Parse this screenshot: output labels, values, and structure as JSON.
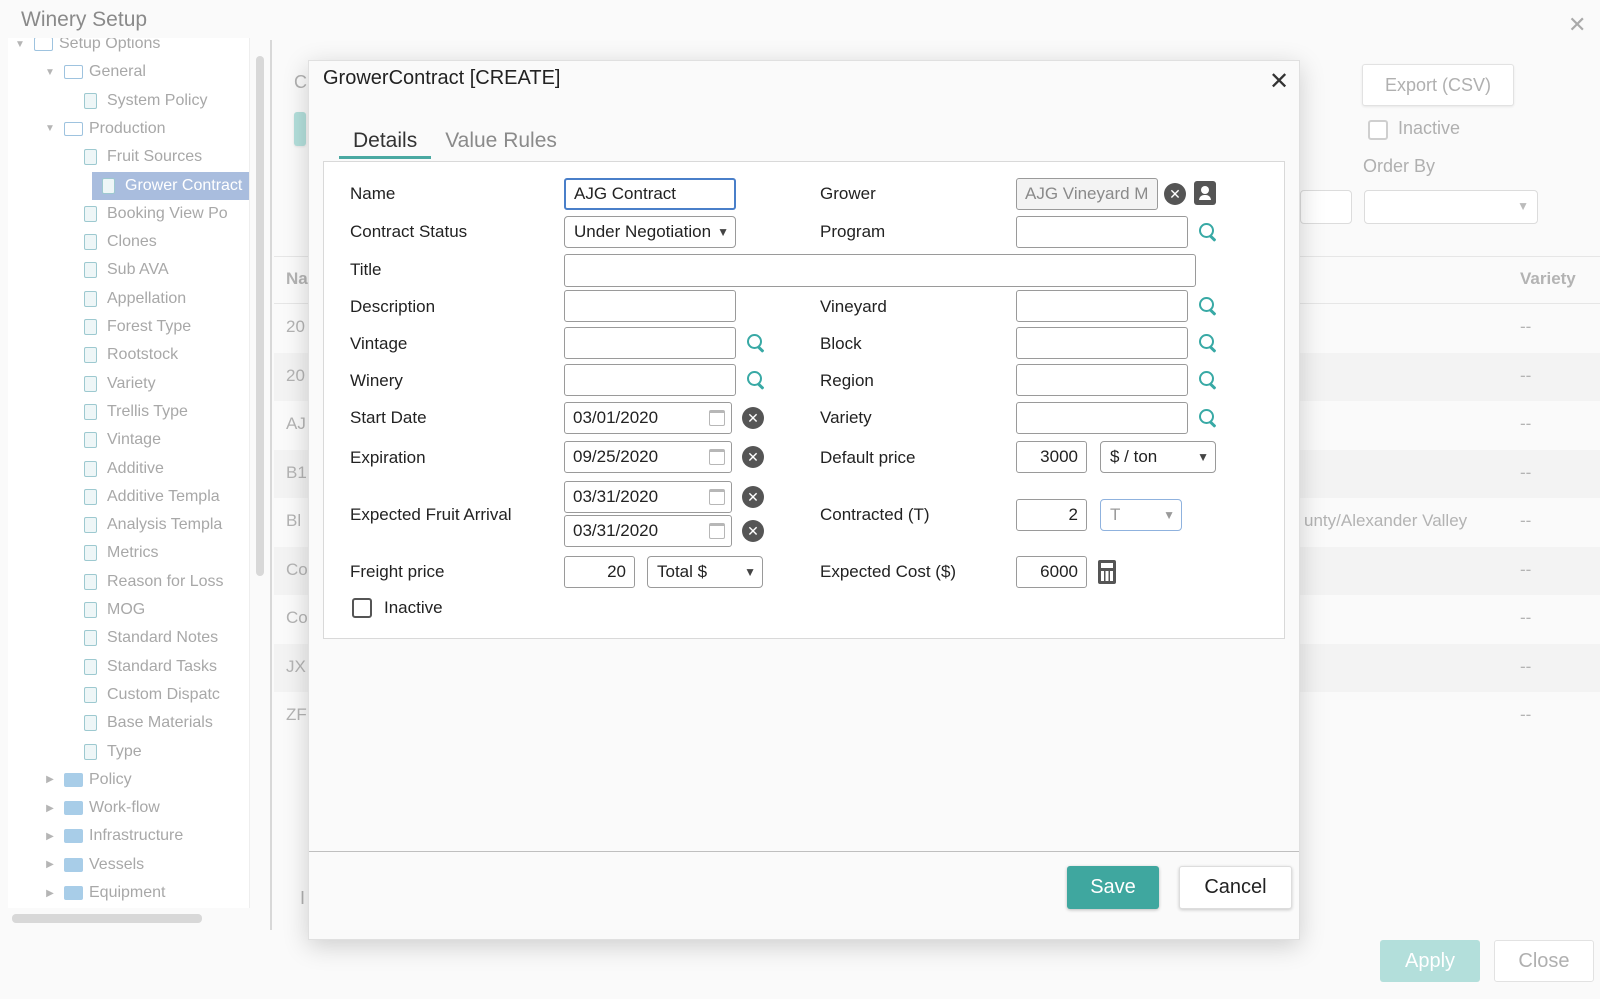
{
  "window": {
    "title": "Winery Setup",
    "close_glyph": "✕"
  },
  "tree": {
    "items": [
      {
        "label": "Setup Options",
        "kind": "folder",
        "level": 0,
        "expanded": true
      },
      {
        "label": "General",
        "kind": "folder",
        "level": 1,
        "expanded": true
      },
      {
        "label": "System Policy",
        "kind": "doc",
        "level": 2
      },
      {
        "label": "Production",
        "kind": "folder",
        "level": 1,
        "expanded": true
      },
      {
        "label": "Fruit Sources",
        "kind": "doc",
        "level": 2
      },
      {
        "label": "Grower Contract",
        "kind": "doc",
        "level": 2,
        "selected": true
      },
      {
        "label": "Booking View Po",
        "kind": "doc",
        "level": 2
      },
      {
        "label": "Clones",
        "kind": "doc",
        "level": 2
      },
      {
        "label": "Sub AVA",
        "kind": "doc",
        "level": 2
      },
      {
        "label": "Appellation",
        "kind": "doc",
        "level": 2
      },
      {
        "label": "Forest Type",
        "kind": "doc",
        "level": 2
      },
      {
        "label": "Rootstock",
        "kind": "doc",
        "level": 2
      },
      {
        "label": "Variety",
        "kind": "doc",
        "level": 2
      },
      {
        "label": "Trellis Type",
        "kind": "doc",
        "level": 2
      },
      {
        "label": "Vintage",
        "kind": "doc",
        "level": 2
      },
      {
        "label": "Additive",
        "kind": "doc",
        "level": 2
      },
      {
        "label": "Additive Templa",
        "kind": "doc",
        "level": 2
      },
      {
        "label": "Analysis Templa",
        "kind": "doc",
        "level": 2
      },
      {
        "label": "Metrics",
        "kind": "doc",
        "level": 2
      },
      {
        "label": "Reason for Loss",
        "kind": "doc",
        "level": 2
      },
      {
        "label": "MOG",
        "kind": "doc",
        "level": 2
      },
      {
        "label": "Standard Notes",
        "kind": "doc",
        "level": 2
      },
      {
        "label": "Standard Tasks",
        "kind": "doc",
        "level": 2
      },
      {
        "label": "Custom Dispatc",
        "kind": "doc",
        "level": 2
      },
      {
        "label": "Base Materials",
        "kind": "doc",
        "level": 2
      },
      {
        "label": "Type",
        "kind": "doc",
        "level": 2
      },
      {
        "label": "Policy",
        "kind": "folder-closed",
        "level": 1
      },
      {
        "label": "Work-flow",
        "kind": "folder-closed",
        "level": 1
      },
      {
        "label": "Infrastructure",
        "kind": "folder-closed",
        "level": 1
      },
      {
        "label": "Vessels",
        "kind": "folder-closed",
        "level": 1
      },
      {
        "label": "Equipment",
        "kind": "folder-closed",
        "level": 1
      }
    ]
  },
  "background": {
    "c_label": "C",
    "export_label": "Export (CSV)",
    "inactive_label": "Inactive",
    "order_by_label": "Order By",
    "col_name": "Na",
    "col_variety": "Variety",
    "rows": [
      {
        "name": "20",
        "mid": "",
        "variety": "--"
      },
      {
        "name": "20",
        "mid": "",
        "variety": "--"
      },
      {
        "name": "AJ",
        "mid": "",
        "variety": "--"
      },
      {
        "name": "B1",
        "mid": "",
        "variety": "--"
      },
      {
        "name": "Bl",
        "mid": "unty/Alexander Valley",
        "variety": "--"
      },
      {
        "name": "Co",
        "mid": "",
        "variety": "--"
      },
      {
        "name": "Co",
        "mid": "",
        "variety": "--"
      },
      {
        "name": "JX",
        "mid": "",
        "variety": "--"
      },
      {
        "name": "ZF",
        "mid": "",
        "variety": "--"
      }
    ],
    "apply_label": "Apply",
    "close_label": "Close",
    "footer_stub": "I"
  },
  "modal": {
    "title": "GrowerContract [CREATE]",
    "close_glyph": "✕",
    "tabs": [
      {
        "label": "Details",
        "active": true
      },
      {
        "label": "Value Rules",
        "active": false
      }
    ],
    "labels": {
      "name": "Name",
      "contract_status": "Contract Status",
      "title": "Title",
      "description": "Description",
      "vintage": "Vintage",
      "winery": "Winery",
      "start_date": "Start Date",
      "expiration": "Expiration",
      "expected_fruit_arrival": "Expected Fruit Arrival",
      "freight_price": "Freight price",
      "inactive": "Inactive",
      "grower": "Grower",
      "program": "Program",
      "vineyard": "Vineyard",
      "block": "Block",
      "region": "Region",
      "variety": "Variety",
      "default_price": "Default price",
      "contracted": "Contracted (T)",
      "expected_cost": "Expected Cost ($)"
    },
    "values": {
      "name": "AJG Contract",
      "contract_status": "Under Negotiation",
      "title": "",
      "description": "",
      "vintage": "",
      "winery": "",
      "start_date": "03/01/2020",
      "expiration": "09/25/2020",
      "arrival_start": "03/31/2020",
      "arrival_end": "03/31/2020",
      "freight_price": "20",
      "freight_unit": "Total $",
      "grower": "AJG Vineyard Management",
      "program": "",
      "vineyard": "",
      "block": "",
      "region": "",
      "variety": "",
      "default_price": "3000",
      "price_unit": "$ / ton",
      "contracted": "2",
      "contracted_unit": "T",
      "expected_cost": "6000"
    },
    "save_label": "Save",
    "cancel_label": "Cancel"
  },
  "colors": {
    "accent": "#3fa79f",
    "search_icon": "#38a9a5",
    "focus_border": "#4a7fc9",
    "tree_selected": "#a9bdde"
  }
}
